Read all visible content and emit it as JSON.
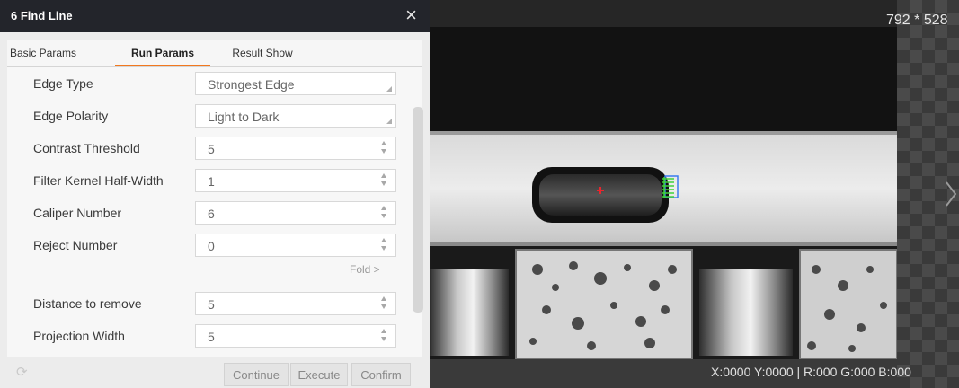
{
  "dialog": {
    "title": "6 Find Line",
    "close_icon": "×",
    "tabs": [
      {
        "label": "Basic Params",
        "active": false
      },
      {
        "label": "Run Params",
        "active": true
      },
      {
        "label": "Result Show",
        "active": false
      }
    ],
    "params": [
      {
        "label": "Edge Type",
        "value": "Strongest Edge",
        "kind": "combo"
      },
      {
        "label": "Edge Polarity",
        "value": "Light to Dark",
        "kind": "combo"
      },
      {
        "label": "Contrast Threshold",
        "value": "5",
        "kind": "spin"
      },
      {
        "label": "Filter Kernel Half-Width",
        "value": "1",
        "kind": "spin"
      },
      {
        "label": "Caliper Number",
        "value": "6",
        "kind": "spin"
      },
      {
        "label": "Reject Number",
        "value": "0",
        "kind": "spin"
      },
      {
        "label": "Distance to remove",
        "value": "5",
        "kind": "spin"
      },
      {
        "label": "Projection Width",
        "value": "5",
        "kind": "spin"
      }
    ],
    "fold_label": "Fold >",
    "buttons": {
      "continue": "Continue",
      "execute": "Execute",
      "confirm": "Confirm"
    },
    "reset_icon": "⟳"
  },
  "viewer": {
    "image_size": "792 * 528",
    "pixel_info": "X:0000  Y:0000  |  R:000  G:000  B:000",
    "accent_colors": {
      "marker": "#e8262e",
      "caliper": "#3fd23a",
      "caliper_box": "#3a7cf0"
    }
  }
}
